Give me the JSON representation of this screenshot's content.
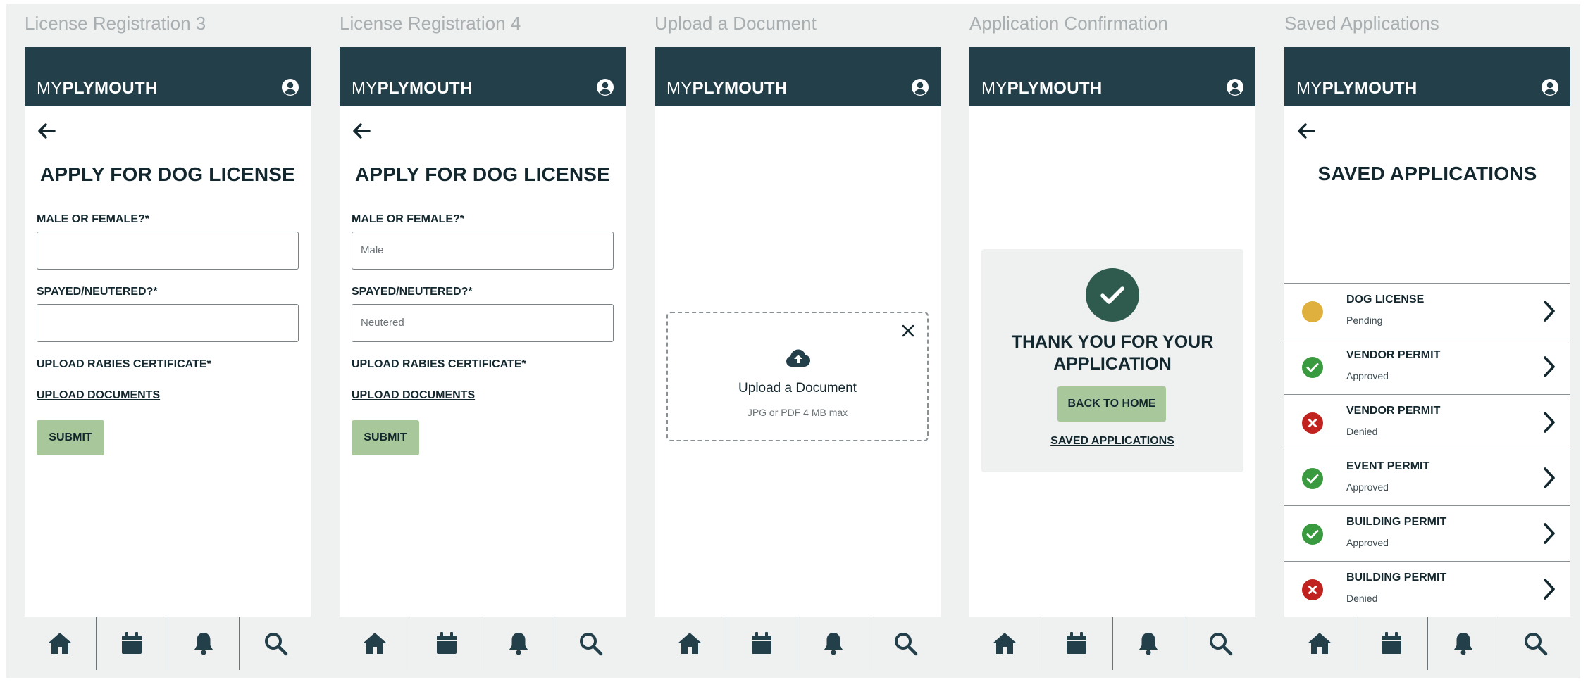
{
  "colors": {
    "header": "#233f4a",
    "accent_green": "#a8c79a",
    "approved": "#3a9a3f",
    "denied": "#c0231f",
    "pending": "#e0b03e",
    "canvas": "#eff1f1"
  },
  "brand": {
    "light": "MY",
    "bold": "PLYMOUTH"
  },
  "nav_icons": [
    "home-icon",
    "calendar-icon",
    "bell-icon",
    "search-icon"
  ],
  "frames": [
    {
      "title": "License Registration 3",
      "screen_title": "APPLY FOR DOG LICENSE",
      "sex_label": "MALE OR FEMALE?*",
      "sex_value": "",
      "spay_label": "SPAYED/NEUTERED?*",
      "spay_value": "",
      "rabies_label": "UPLOAD RABIES CERTIFICATE*",
      "upload_link": "UPLOAD DOCUMENTS",
      "submit": "SUBMIT"
    },
    {
      "title": "License Registration 4",
      "screen_title": "APPLY FOR DOG LICENSE",
      "sex_label": "MALE OR FEMALE?*",
      "sex_value": "Male",
      "spay_label": "SPAYED/NEUTERED?*",
      "spay_value": "Neutered",
      "rabies_label": "UPLOAD RABIES CERTIFICATE*",
      "upload_link": "UPLOAD DOCUMENTS",
      "submit": "SUBMIT"
    },
    {
      "title": "Upload a Document",
      "upload_text": "Upload a Document",
      "upload_hint": "JPG or PDF 4 MB max",
      "close": "X"
    },
    {
      "title": "Application Confirmation",
      "thanks_line1": "THANK YOU FOR YOUR",
      "thanks_line2": "APPLICATION",
      "back_home": "BACK TO HOME",
      "saved_link": "SAVED APPLICATIONS"
    },
    {
      "title": "Saved Applications",
      "screen_title": "SAVED APPLICATIONS",
      "applications": [
        {
          "name": "DOG LICENSE",
          "status": "Pending",
          "state": "pending"
        },
        {
          "name": "VENDOR PERMIT",
          "status": "Approved",
          "state": "approved"
        },
        {
          "name": "VENDOR PERMIT",
          "status": "Denied",
          "state": "denied"
        },
        {
          "name": "EVENT PERMIT",
          "status": "Approved",
          "state": "approved"
        },
        {
          "name": "BUILDING PERMIT",
          "status": "Approved",
          "state": "approved"
        },
        {
          "name": "BUILDING PERMIT",
          "status": "Denied",
          "state": "denied"
        }
      ]
    }
  ]
}
